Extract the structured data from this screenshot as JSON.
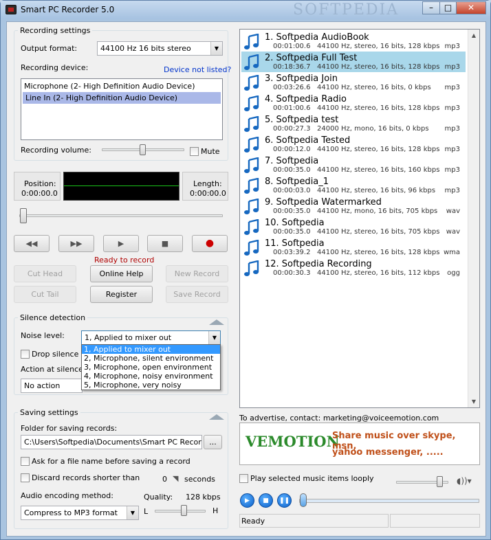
{
  "window": {
    "title": "Smart PC Recorder 5.0",
    "watermark": "SOFTPEDIA",
    "min": "–",
    "max": "□",
    "close": "✕"
  },
  "recording": {
    "group": "Recording settings",
    "format_label": "Output format:",
    "format_value": "44100 Hz 16 bits stereo",
    "device_label": "Recording device:",
    "device_link": "Device not listed?",
    "devices": [
      "Microphone (2- High Definition Audio Device)",
      "Line In (2- High Definition Audio Device)"
    ],
    "selected_device": 1,
    "volume_label": "Recording volume:",
    "volume_level": 0.5,
    "mute_label": "Mute"
  },
  "transport": {
    "position_label": "Position:",
    "position_value": "0:00:00.0",
    "length_label": "Length:",
    "length_value": "0:00:00.0",
    "status": "Ready to record"
  },
  "actions": {
    "cut_head": "Cut Head",
    "online_help": "Online Help",
    "new_record": "New Record",
    "cut_tail": "Cut Tail",
    "register": "Register",
    "save_record": "Save Record"
  },
  "silence": {
    "group": "Silence detection",
    "noise_label": "Noise level:",
    "noise_value": "1, Applied to mixer out",
    "drop_label": "Drop silence at",
    "action_label": "Action at silence lo",
    "action_value": "No action",
    "options": [
      "1, Applied to mixer out",
      "2, Microphone, silent environment",
      "3, Microphone, open environment",
      "4, Microphone, noisy environment",
      "5, Microphone, very noisy"
    ]
  },
  "saving": {
    "group": "Saving settings",
    "folder_label": "Folder for saving records:",
    "folder_value": "C:\\Users\\Softpedia\\Documents\\Smart PC Recorder R",
    "browse": "...",
    "ask_label": "Ask for a file name before saving a record",
    "discard_label": "Discard records shorter than",
    "discard_value": "0",
    "seconds": "seconds",
    "encoding_label": "Audio encoding method:",
    "quality_label": "Quality:",
    "quality_value": "128 kbps",
    "encoding_value": "Compress to MP3 format",
    "low": "L",
    "high": "H",
    "quality_level": 0.6
  },
  "tracks": [
    {
      "title": "1. Softpedia AudioBook",
      "dur": "00:01:00.6",
      "info": "44100 Hz, stereo, 16 bits, 128 kbps",
      "ext": "mp3"
    },
    {
      "title": "2. Softpedia Full Test",
      "dur": "00:18:36.7",
      "info": "44100 Hz, stereo, 16 bits, 128 kbps",
      "ext": "mp3"
    },
    {
      "title": "3. Softpedia Join",
      "dur": "00:03:26.6",
      "info": "44100 Hz, stereo, 16 bits, 0 kbps",
      "ext": "mp3"
    },
    {
      "title": "4. Softpedia Radio",
      "dur": "00:01:00.6",
      "info": "44100 Hz, stereo, 16 bits, 128 kbps",
      "ext": "mp3"
    },
    {
      "title": "5. Softpedia test",
      "dur": "00:00:27.3",
      "info": "24000 Hz, mono, 16 bits, 0 kbps",
      "ext": "mp3"
    },
    {
      "title": "6. Softpedia Tested",
      "dur": "00:00:12.0",
      "info": "44100 Hz, stereo, 16 bits, 128 kbps",
      "ext": "mp3"
    },
    {
      "title": "7. Softpedia",
      "dur": "00:00:35.0",
      "info": "44100 Hz, stereo, 16 bits, 160 kbps",
      "ext": "mp3"
    },
    {
      "title": "8. Softpedia_1",
      "dur": "00:00:03.0",
      "info": "44100 Hz, stereo, 16 bits, 96 kbps",
      "ext": "mp3"
    },
    {
      "title": "9. Softpedia Watermarked",
      "dur": "00:00:35.0",
      "info": "44100 Hz, mono, 16 bits, 705 kbps",
      "ext": "wav"
    },
    {
      "title": "10. Softpedia",
      "dur": "00:00:35.0",
      "info": "44100 Hz, stereo, 16 bits, 705 kbps",
      "ext": "wav"
    },
    {
      "title": "11. Softpedia",
      "dur": "00:03:39.2",
      "info": "44100 Hz, stereo, 16 bits, 128 kbps",
      "ext": "wma"
    },
    {
      "title": "12. Softpedia Recording",
      "dur": "00:00:30.3",
      "info": "44100 Hz, stereo, 16 bits, 112 kbps",
      "ext": "ogg"
    }
  ],
  "selected_track": 1,
  "ad": {
    "contact": "To advertise, contact: marketing@voiceemotion.com",
    "logo": "VEMOTION",
    "line1": "Share music over skype, msn,",
    "line2": "yahoo messenger, .....",
    "colors": {
      "logo": "#2b8a2b",
      "text": "#c0501a"
    }
  },
  "player": {
    "loop_label": "Play selected music items looply",
    "status": "Ready",
    "volume_level": 0.9
  },
  "colors": {
    "selection": "#a9d7ea",
    "record": "#cc0000",
    "accent": "#1a6fd6"
  }
}
